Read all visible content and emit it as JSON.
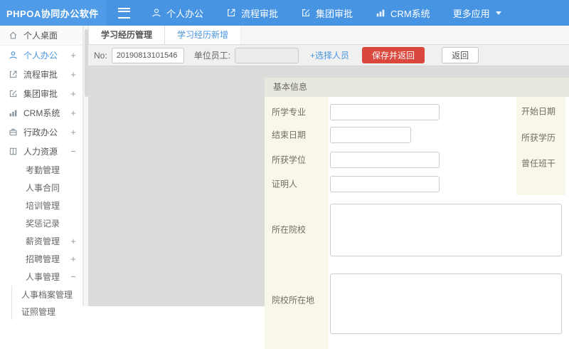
{
  "colors": {
    "navbar_blue": "#4794e2",
    "logo_blue": "#4f9be7",
    "accent_blue": "#4794e2",
    "save_button_red": "#d9473d",
    "workspace_gray": "#dcdcda",
    "panel_header_bg": "#e9e8df",
    "label_column_bg": "#f8f7ea"
  },
  "app": {
    "title": "PHPOA协同办公软件"
  },
  "topnav": {
    "items": [
      {
        "label": "个人办公",
        "icon": "user-icon"
      },
      {
        "label": "流程审批",
        "icon": "submit-icon"
      },
      {
        "label": "集团审批",
        "icon": "edit-icon"
      },
      {
        "label": "CRM系统",
        "icon": "bar-chart-icon"
      },
      {
        "label": "更多应用",
        "icon": "caret-down-icon"
      }
    ]
  },
  "sidebar": {
    "desktop_label": "个人桌面",
    "items": [
      {
        "label": "个人办公",
        "expander": "+"
      },
      {
        "label": "流程审批",
        "expander": "+"
      },
      {
        "label": "集团审批",
        "expander": "+"
      },
      {
        "label": "CRM系统",
        "expander": "+"
      },
      {
        "label": "行政办公",
        "expander": "+"
      },
      {
        "label": "人力资源",
        "expander": "−"
      }
    ],
    "hr_items": [
      {
        "label": "考勤管理",
        "expander": ""
      },
      {
        "label": "人事合同",
        "expander": ""
      },
      {
        "label": "培训管理",
        "expander": ""
      },
      {
        "label": "奖惩记录",
        "expander": ""
      },
      {
        "label": "薪资管理",
        "expander": "+"
      },
      {
        "label": "招聘管理",
        "expander": "+"
      },
      {
        "label": "人事管理",
        "expander": "−"
      }
    ],
    "personnel_items": [
      {
        "label": "人事档案管理"
      },
      {
        "label": "证照管理"
      }
    ]
  },
  "tabs": [
    {
      "label": "学习经历管理",
      "active": false
    },
    {
      "label": "学习经历新增",
      "active": true
    }
  ],
  "toolbar": {
    "no_label": "No:",
    "no_value": "20190813101546",
    "employee_label": "单位员工:",
    "employee_value": "",
    "select_person_label": "+选择人员",
    "save_label": "保存并返回",
    "back_label": "返回"
  },
  "form": {
    "section_title": "基本信息",
    "left_fields": [
      {
        "label": "所学专业",
        "value": ""
      },
      {
        "label": "结束日期",
        "value": ""
      },
      {
        "label": "所获学位",
        "value": ""
      },
      {
        "label": "证明人",
        "value": ""
      },
      {
        "label": "所在院校",
        "value": ""
      },
      {
        "label": "院校所在地",
        "value": ""
      }
    ],
    "right_fields": [
      {
        "label": "开始日期"
      },
      {
        "label": "所获学历"
      },
      {
        "label": "曾任班干"
      }
    ]
  }
}
